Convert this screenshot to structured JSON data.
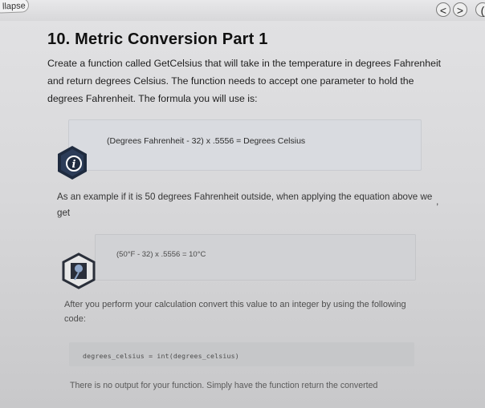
{
  "topbar": {
    "collapse_label": "llapse",
    "prev_label": "<",
    "next_label": ">",
    "extra_label": "("
  },
  "lesson": {
    "title": "10. Metric Conversion Part 1",
    "intro": "Create a function called GetCelsius that will take in the temperature in degrees Fahrenheit and return degrees Celsius. The function needs to accept one parameter to hold the degrees Fahrenheit. The formula you will use is:",
    "formula": "(Degrees Fahrenheit - 32) x .5556 = Degrees Celsius",
    "example_intro": "As an example if it is 50 degrees Fahrenheit outside, when applying the equation above we get",
    "comma_mark": ",",
    "example_formula": "(50°F - 32) x .5556 = 10°C",
    "convert_instruction": "After you perform your calculation convert this value to an integer by using the following code:",
    "code": "degrees_celsius = int(degrees_celsius)",
    "output_note": "There is no output for your function. Simply have the function return the converted"
  },
  "icons": {
    "info_icon": "info-icon",
    "pin_icon": "pin-icon"
  },
  "colors": {
    "callout_box": "#d9dbe0",
    "code_box": "#c6c7c9",
    "icon_dark": "#1f2b3f"
  }
}
